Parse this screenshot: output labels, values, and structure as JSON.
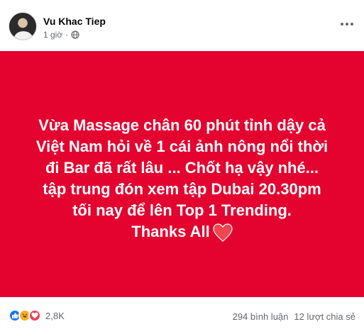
{
  "post": {
    "author": "Vu Khac Tiep",
    "time": "1 giờ",
    "dot": "·",
    "privacy_icon": "globe-icon",
    "more_icon": "more-options-icon"
  },
  "content": {
    "background_color": "#e4022f",
    "lines": [
      "Vừa Massage chân 60 phút tỉnh dậy cả",
      "Việt Nam hỏi về 1 cái ảnh nông nổi thời",
      "đi Bar đã rất lâu ... Chốt hạ vậy nhé...",
      "tập trung đón xem tập Dubai 20.30pm",
      "tối nay để lên Top 1 Trending.",
      "Thanks All"
    ],
    "heart_icon": "heart-icon"
  },
  "footer": {
    "reaction_icons": [
      "like-icon",
      "haha-icon",
      "love-icon"
    ],
    "reaction_count": "2,8K",
    "comments": "294 bình luận",
    "shares": "12 lượt chia sẻ"
  }
}
